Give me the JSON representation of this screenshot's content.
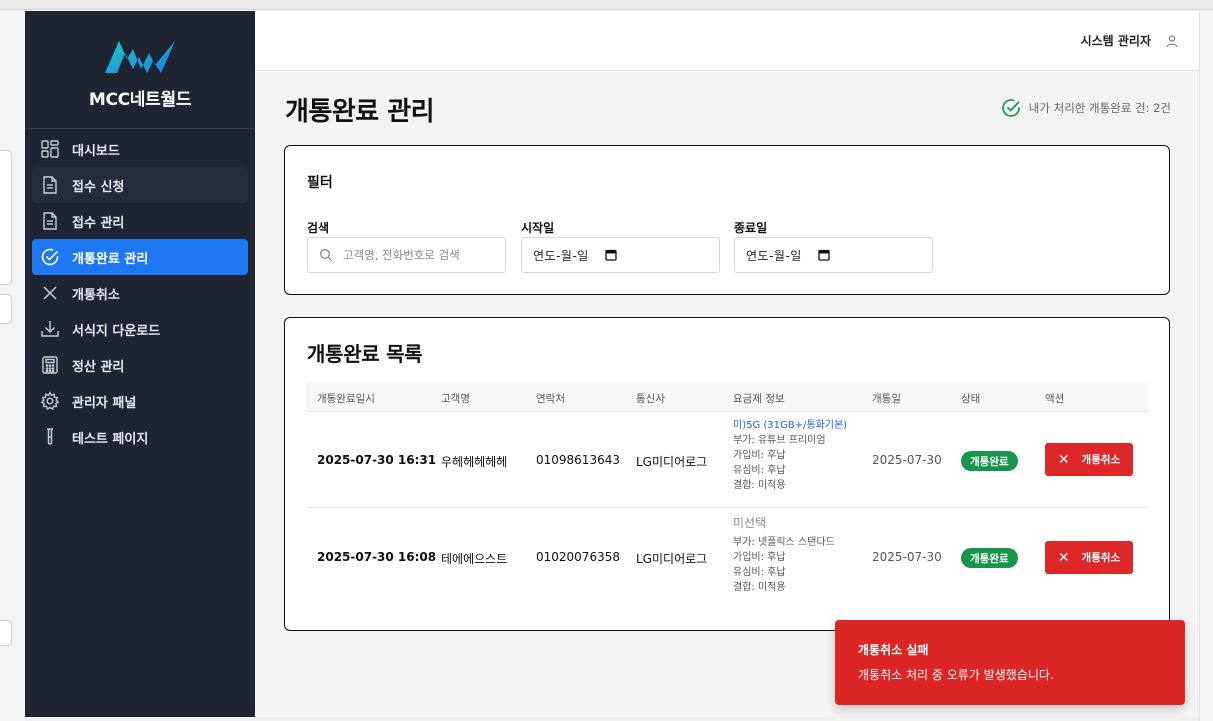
{
  "brand": {
    "name": "MCC네트월드"
  },
  "sidebar": {
    "items": [
      {
        "label": "대시보드",
        "icon": "dashboard-icon"
      },
      {
        "label": "접수 신청",
        "icon": "document-icon"
      },
      {
        "label": "접수 관리",
        "icon": "document-icon"
      },
      {
        "label": "개통완료 관리",
        "icon": "check-circle-icon"
      },
      {
        "label": "개통취소",
        "icon": "close-icon"
      },
      {
        "label": "서식지 다운로드",
        "icon": "download-icon"
      },
      {
        "label": "정산 관리",
        "icon": "calculator-icon"
      },
      {
        "label": "관리자 패널",
        "icon": "gear-icon"
      },
      {
        "label": "테스트 페이지",
        "icon": "test-tube-icon"
      }
    ],
    "active_index": 3
  },
  "header": {
    "admin_name": "시스템 관리자"
  },
  "page": {
    "title": "개통완료 관리",
    "done_count_text": "내가 처리한 개통완료 건: 2건"
  },
  "filter": {
    "title": "필터",
    "search_label": "검색",
    "search_placeholder": "고객명, 전화번호로 검색",
    "start_label": "시작일",
    "start_value": "연도-월-일",
    "end_label": "종료일",
    "end_value": "연도-월-일"
  },
  "list": {
    "title": "개통완료 목록",
    "columns": [
      "개통완료일시",
      "고객명",
      "연락처",
      "통신사",
      "요금제 정보",
      "개통일",
      "상태",
      "액션"
    ],
    "rows": [
      {
        "completed_at": "2025-07-30 16:31",
        "customer": "우헤헤헤헤헤",
        "phone": "01098613643",
        "carrier": "LG미디어로그",
        "plan_name": "미)5G (31GB+/통화기본)",
        "addon": "부가: 유튜브 프리미엄",
        "join_fee": "가입비: 후납",
        "sim_fee": "유심비: 후납",
        "bundle": "결합: 미적용",
        "open_date": "2025-07-30",
        "status": "개통완료",
        "action": "개통취소"
      },
      {
        "completed_at": "2025-07-30 16:08",
        "customer": "테에에으스트",
        "phone": "01020076358",
        "carrier": "LG미디어로그",
        "plan_name": "미선택",
        "addon": "부가: 넷플릭스 스탠다드",
        "join_fee": "가입비: 후납",
        "sim_fee": "유심비: 후납",
        "bundle": "결합: 미적용",
        "open_date": "2025-07-30",
        "status": "개통완료",
        "action": "개통취소"
      }
    ]
  },
  "toast": {
    "title": "개통취소 실패",
    "message": "개통취소 처리 중 오류가 발생했습니다."
  },
  "colors": {
    "sidebar_bg": "#1f2532",
    "accent": "#1d78f2",
    "success": "#17964a",
    "danger": "#dc2828"
  }
}
